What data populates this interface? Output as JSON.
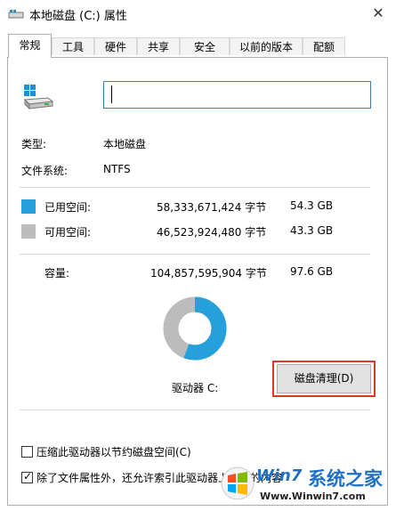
{
  "window": {
    "title": "本地磁盘 (C:) 属性",
    "close_glyph": "✕"
  },
  "tabs": [
    {
      "label": "常规",
      "active": true
    },
    {
      "label": "工具"
    },
    {
      "label": "硬件"
    },
    {
      "label": "共享"
    },
    {
      "label": "安全"
    },
    {
      "label": "以前的版本"
    },
    {
      "label": "配额"
    }
  ],
  "general": {
    "name_value": "",
    "type_label": "类型:",
    "type_value": "本地磁盘",
    "fs_label": "文件系统:",
    "fs_value": "NTFS",
    "used": {
      "label": "已用空间:",
      "bytes": "58,333,671,424 字节",
      "size": "54.3 GB",
      "color": "#26a0da"
    },
    "free": {
      "label": "可用空间:",
      "bytes": "46,523,924,480 字节",
      "size": "43.3 GB",
      "color": "#bcbcbc"
    },
    "capacity": {
      "label": "容量:",
      "bytes": "104,857,595,904 字节",
      "size": "97.6 GB"
    },
    "used_fraction": 0.557,
    "drive_label": "驱动器 C:",
    "cleanup_button": "磁盘清理(D)",
    "compress_label": "压缩此驱动器以节约磁盘空间(C)",
    "compress_checked": false,
    "index_label": "除了文件属性外，还允许索引此驱动器上文件的内容",
    "index_checked": true
  },
  "watermark": {
    "brand_text": "系统之家",
    "url": "Www.Winwin7.com",
    "logo_text": "Win7"
  }
}
